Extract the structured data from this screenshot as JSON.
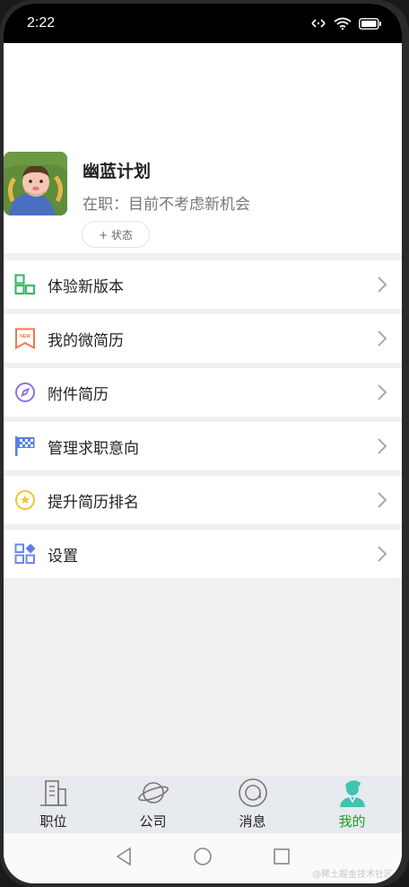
{
  "status_bar": {
    "time": "2:22"
  },
  "profile": {
    "name": "幽蓝计划",
    "status_text": "在职：目前不考虑新机会",
    "status_button": "+ 状态"
  },
  "menu": [
    {
      "label": "体验新版本",
      "icon": "new-version-icon",
      "color": "#3cb964"
    },
    {
      "label": "我的微简历",
      "icon": "micro-resume-bookmark-icon",
      "color": "#f07a4a"
    },
    {
      "label": "附件简历",
      "icon": "compass-icon",
      "color": "#8a74e0"
    },
    {
      "label": "管理求职意向",
      "icon": "flag-icon",
      "color": "#5b7ee8"
    },
    {
      "label": "提升简历排名",
      "icon": "star-badge-icon",
      "color": "#f3c531"
    },
    {
      "label": "设置",
      "icon": "settings-grid-icon",
      "color": "#6f87e6"
    }
  ],
  "tabs": [
    {
      "label": "职位",
      "icon": "building-icon",
      "active": false
    },
    {
      "label": "公司",
      "icon": "planet-icon",
      "active": false
    },
    {
      "label": "消息",
      "icon": "message-circle-icon",
      "active": false
    },
    {
      "label": "我的",
      "icon": "person-icon",
      "active": true
    }
  ],
  "colors": {
    "accent_green": "#1a9d2e",
    "active_tab_icon": "#3fc4b2"
  },
  "watermark": "@稀土掘金技术社区"
}
